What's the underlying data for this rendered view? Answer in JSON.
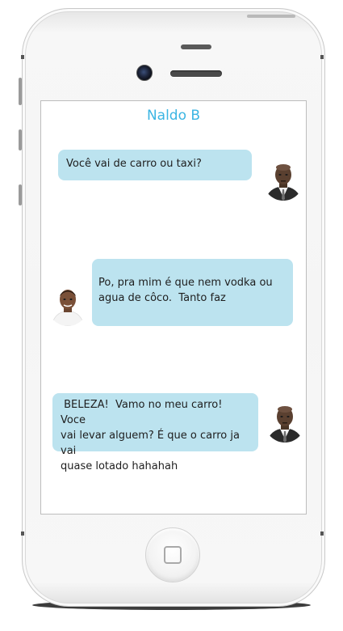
{
  "chat": {
    "contact_name": "Naldo B"
  },
  "messages": [
    {
      "sender": "naldo",
      "text": "Você vai de carro ou taxi?"
    },
    {
      "sender": "friend",
      "text": "Po, pra mim é que nem vodka ou\nagua de côco.  Tanto faz"
    },
    {
      "sender": "naldo",
      "text": " BELEZA!  Vamo no meu carro!  Voce\nvai levar alguem? É que o carro ja vai\nquase lotado hahahah"
    }
  ],
  "colors": {
    "bubble": "#bce3ef",
    "contact_name": "#3bb5e3",
    "screen": "#ffffff",
    "phone_body": "#f5f5f5"
  }
}
